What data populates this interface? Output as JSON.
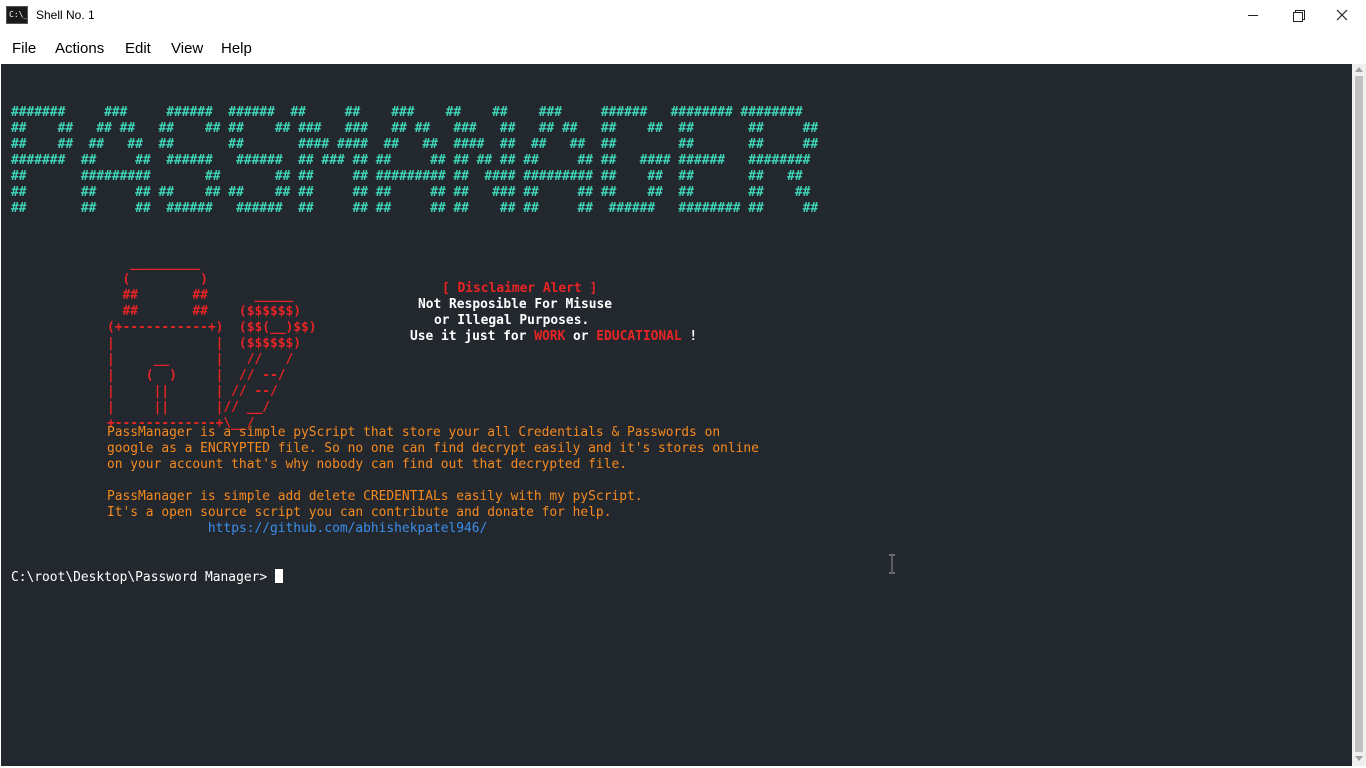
{
  "window": {
    "title": "Shell No. 1",
    "app_icon_text": "C:\\_"
  },
  "menu": {
    "file": "File",
    "actions": "Actions",
    "edit": "Edit",
    "view": "View",
    "help": "Help"
  },
  "terminal": {
    "banner": "#######     ###     ######  ######  ##     ##    ###    ##    ##    ###     ######   ######## ########\n##    ##   ## ##   ##    ## ##    ## ###   ###   ## ##   ###   ##   ## ##   ##    ##  ##       ##     ##\n##    ##  ##   ##  ##       ##       #### ####  ##   ##  ####  ##  ##   ##  ##        ##       ##     ##\n#######  ##     ##  ######   ######  ## ### ## ##     ## ## ## ## ##     ## ##   #### ######   ########\n##       #########       ##       ## ##     ## ######### ##  #### ######### ##    ##  ##       ##   ##\n##       ##     ## ##    ## ##    ## ##     ## ##     ## ##   ### ##     ## ##    ##  ##       ##    ##\n##       ##     ##  ######   ######  ##     ## ##     ## ##    ## ##     ##  ######   ######## ##     ##",
    "lock_art": "   _________\n  (         )\n  ##       ##      _____\n  ##       ##    ($$$$$$)\n(+-----------+)  ($$(__)$$)\n|             |  ($$$$$$)\n|     __      |   //   /\n|    (  )     |  // --/\n|     ||      | // --/\n|     ||      |// __/\n+-------------+\\__/",
    "disclaimer": {
      "title": "[ Disclaimer Alert ]",
      "line1": "Not Resposible For Misuse",
      "line2": "or Illegal Purposes.",
      "line3_prefix": "Use it just for ",
      "work": "WORK",
      "or": " or ",
      "educational": "EDUCATIONAL",
      "line3_suffix": " !"
    },
    "info": {
      "line1": "PassManager is a simple pyScript that store your all Credentials & Passwords on",
      "line2": "google as a ENCRYPTED file. So no one can find decrypt easily and it's stores online",
      "line3": "on your account that's why nobody can find out that decrypted file.",
      "line4": "PassManager is simple add delete CREDENTIALs easily with my pyScript.",
      "line5": "It's a open source script you can contribute and donate for help.",
      "link_indent": "             ",
      "link": "https://github.com/abhishekpatel946/"
    },
    "prompt": "C:\\root\\Desktop\\Password Manager> "
  },
  "colors": {
    "terminal_bg": "#23272e",
    "banner": "#3fd6b8",
    "lock": "#e82424",
    "info": "#f58a1f",
    "link": "#3b8eea",
    "prompt": "#ffffff"
  }
}
